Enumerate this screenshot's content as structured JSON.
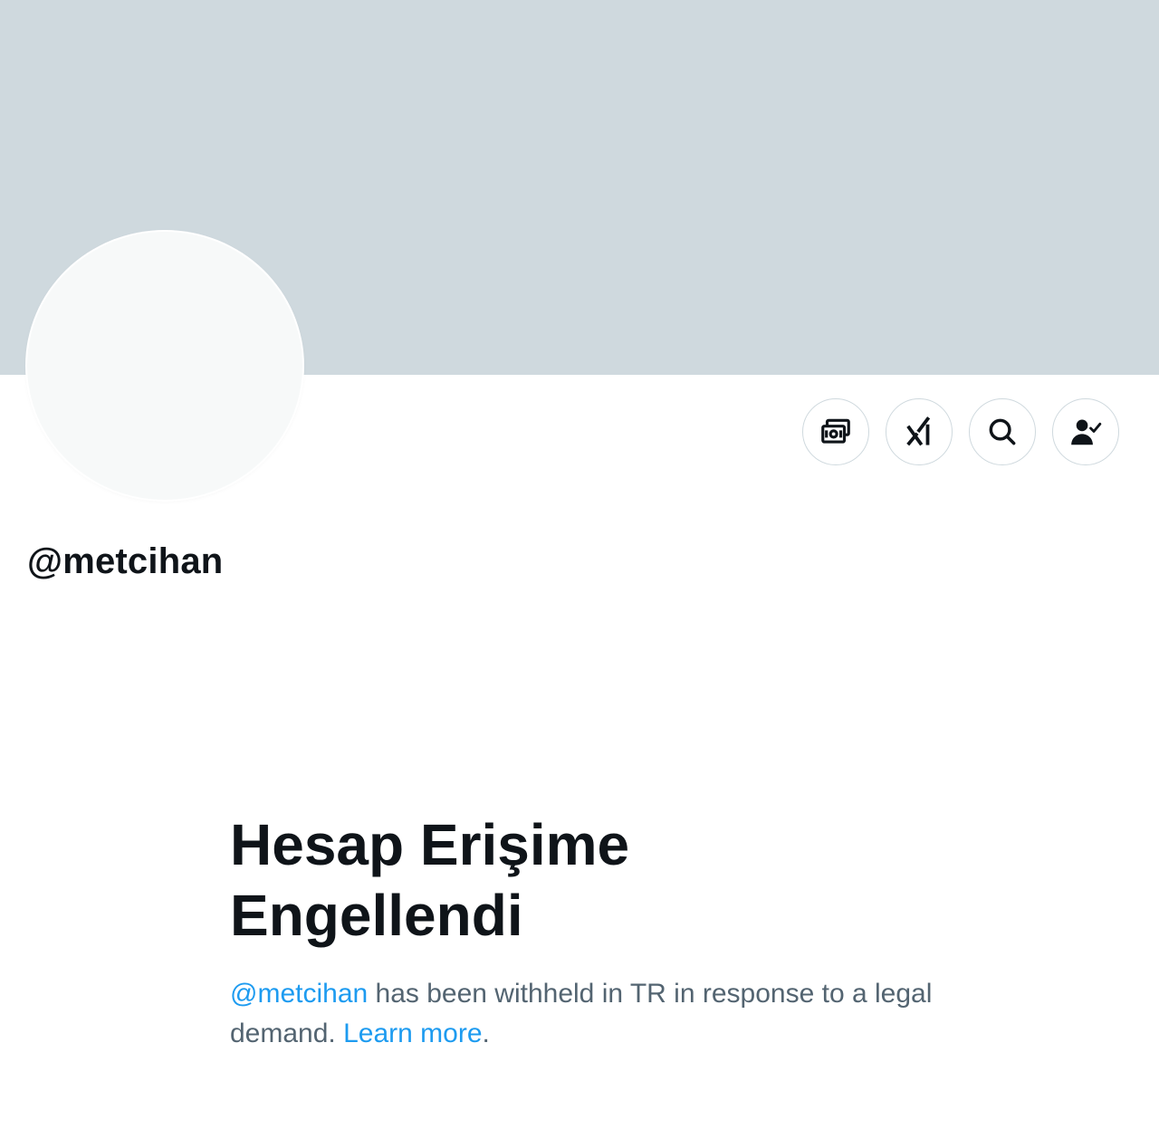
{
  "profile": {
    "handle": "@metcihan"
  },
  "actions": [
    {
      "icon": "monetization-icon"
    },
    {
      "icon": "grok-icon"
    },
    {
      "icon": "search-icon"
    },
    {
      "icon": "follow-user-check-icon"
    }
  ],
  "withheld": {
    "title": "Hesap Erişime Engellendi",
    "handle_link": "@metcihan",
    "message": " has been withheld in TR in response to a legal demand. ",
    "learn_more": "Learn more",
    "period": "."
  },
  "colors": {
    "banner": "#cfd9de",
    "link": "#1d9bf0",
    "secondary_text": "#536471",
    "primary_text": "#0f1419"
  }
}
